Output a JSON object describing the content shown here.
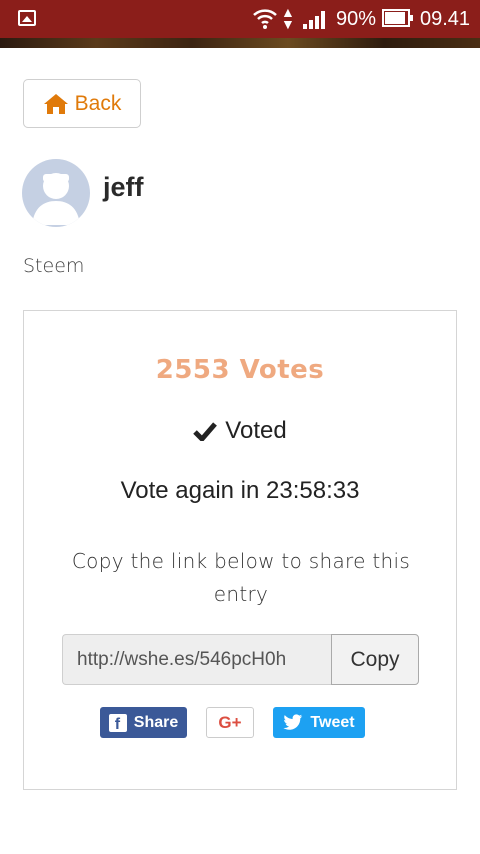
{
  "status_bar": {
    "battery_percent": "90%",
    "time": "09.41",
    "icons": [
      "gallery-icon",
      "wifi-icon",
      "data-arrows-icon",
      "signal-icon",
      "battery-icon"
    ]
  },
  "back_button": {
    "label": "Back",
    "icon": "home-icon",
    "color": "#e07a0a"
  },
  "profile": {
    "username": "jeff",
    "category": "Steem"
  },
  "card": {
    "votes_text": "2553 Votes",
    "voted_label": "Voted",
    "vote_again_text": "Vote again in 23:58:33",
    "share_instruction": "Copy the link below to share this entry",
    "share_link": "http://wshe.es/546pcH0h",
    "copy_label": "Copy"
  },
  "social": {
    "facebook_label": "Share",
    "google_label": "G+",
    "twitter_label": "Tweet",
    "colors": {
      "facebook": "#3b5998",
      "google": "#dc4e41",
      "twitter": "#1da1f2"
    }
  },
  "colors": {
    "accent": "#e07a0a",
    "votes": "#efa980",
    "status_bar": "#8b1e1a"
  }
}
